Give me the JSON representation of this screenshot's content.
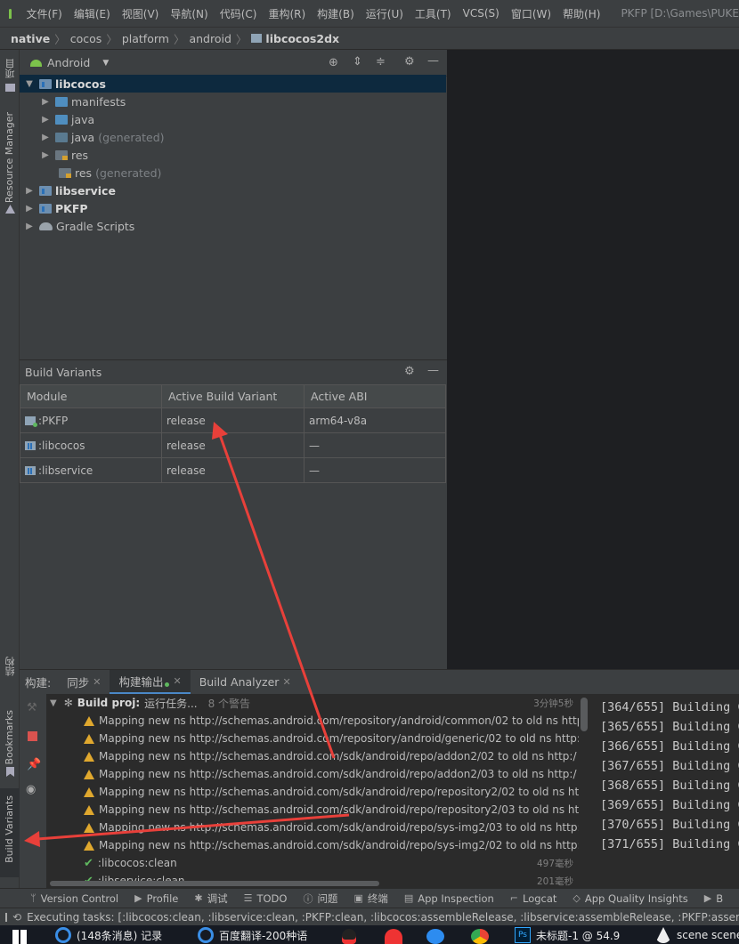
{
  "menubar": {
    "items": [
      "文件(F)",
      "编辑(E)",
      "视图(V)",
      "导航(N)",
      "代码(C)",
      "重构(R)",
      "构建(B)",
      "运行(U)",
      "工具(T)",
      "VCS(S)",
      "窗口(W)",
      "帮助(H)"
    ],
    "window_title": "PKFP [D:\\Games\\PUKE"
  },
  "breadcrumb": [
    "native",
    "cocos",
    "platform",
    "android",
    "libcocos2dx"
  ],
  "left_strip": {
    "project": "项目",
    "resource_manager": "Resource Manager",
    "structure": "结构",
    "bookmarks": "Bookmarks",
    "build_variants": "Build Variants"
  },
  "project": {
    "view_selector": "Android",
    "tree": [
      {
        "label": "libcocos",
        "bold": true,
        "expanded": true
      },
      {
        "label": "manifests"
      },
      {
        "label": "java"
      },
      {
        "label": "java",
        "suffix": "(generated)"
      },
      {
        "label": "res"
      },
      {
        "label": "res",
        "suffix": "(generated)"
      },
      {
        "label": "libservice",
        "bold": true
      },
      {
        "label": "PKFP",
        "bold": true
      },
      {
        "label": "Gradle Scripts"
      }
    ]
  },
  "build_variants": {
    "title": "Build Variants",
    "columns": [
      "Module",
      "Active Build Variant",
      "Active ABI"
    ],
    "rows": [
      [
        ":PKFP",
        "release",
        "arm64-v8a"
      ],
      [
        ":libcocos",
        "release",
        "—"
      ],
      [
        ":libservice",
        "release",
        "—"
      ]
    ]
  },
  "build_panel": {
    "label": "构建:",
    "tabs": [
      "同步",
      "构建输出",
      "Build Analyzer"
    ],
    "root": {
      "title": "Build proj:",
      "status": "运行任务...",
      "warnings": "8 个警告",
      "time": "3分钟5秒"
    },
    "warnings": [
      "Mapping new ns http://schemas.android.com/repository/android/common/02 to old ns http",
      "Mapping new ns http://schemas.android.com/repository/android/generic/02 to old ns http:",
      "Mapping new ns http://schemas.android.com/sdk/android/repo/addon2/02 to old ns http:/",
      "Mapping new ns http://schemas.android.com/sdk/android/repo/addon2/03 to old ns http:/",
      "Mapping new ns http://schemas.android.com/sdk/android/repo/repository2/02 to old ns ht",
      "Mapping new ns http://schemas.android.com/sdk/android/repo/repository2/03 to old ns ht",
      "Mapping new ns http://schemas.android.com/sdk/android/repo/sys-img2/03 to old ns http:",
      "Mapping new ns http://schemas.android.com/sdk/android/repo/sys-img2/02 to old ns http:"
    ],
    "tasks": [
      {
        "label": ":libcocos:clean",
        "time": "497毫秒"
      },
      {
        "label": ":libservice:clean",
        "time": "201毫秒"
      }
    ],
    "console": [
      "[364/655] Building C",
      "[365/655] Building C",
      "[366/655] Building C",
      "[367/655] Building C",
      "[368/655] Building C",
      "[369/655] Building C",
      "[370/655] Building C",
      "[371/655] Building C"
    ]
  },
  "tool_windows": [
    "Version Control",
    "Profile",
    "调试",
    "TODO",
    "问题",
    "终端",
    "App Inspection",
    "Logcat",
    "App Quality Insights",
    "B"
  ],
  "status": "Executing tasks: [:libcocos:clean, :libservice:clean, :PKFP:clean, :libcocos:assembleRelease, :libservice:assembleRelease, :PKFP:assembleRe",
  "taskbar": [
    "(148条消息) 记录",
    "百度翻译-200种语",
    "未标题-1 @ 54.9",
    "scene scene"
  ],
  "colors": {
    "accent": "#4a88c7",
    "warning": "#e0a82e",
    "success": "#5fb85f",
    "annotation_arrow": "#e8403a"
  }
}
